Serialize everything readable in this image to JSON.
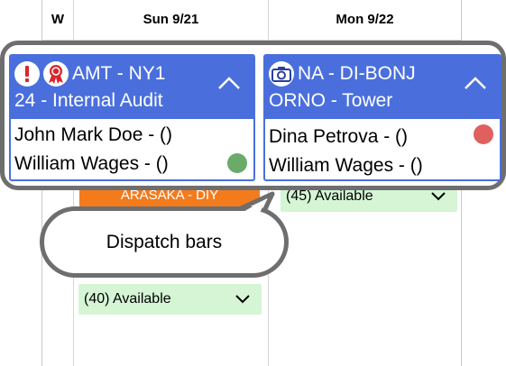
{
  "calendar": {
    "week_col_label": "W",
    "day1_label": "Sun 9/21",
    "day2_label": "Mon 9/22",
    "orange_bar_label": "ARASAKA - DIY",
    "avail_top": "(45) Available",
    "avail_bottom": "(40) Available"
  },
  "cards": [
    {
      "title": "AMT - NY1",
      "subtitle": "24 - Internal Audit",
      "icons": [
        "alert-icon",
        "ribbon-award-icon"
      ],
      "people": [
        "John Mark Doe - ()",
        "William Wages - ()"
      ],
      "status_color": "#6aaa6a"
    },
    {
      "title": "NA - DI-BONJ",
      "subtitle": "ORNO - Tower",
      "icons": [
        "camera-icon"
      ],
      "people": [
        "Dina Petrova - ()",
        "William Wages - ()"
      ],
      "status_color": "#e06060"
    }
  ],
  "callout": {
    "text": "Dispatch bars"
  },
  "colors": {
    "card_header": "#4a6fdc",
    "alert": "#d9262c",
    "frame": "#6e6e6e",
    "available": "#d5f5d5",
    "orange": "#f47b1c"
  }
}
